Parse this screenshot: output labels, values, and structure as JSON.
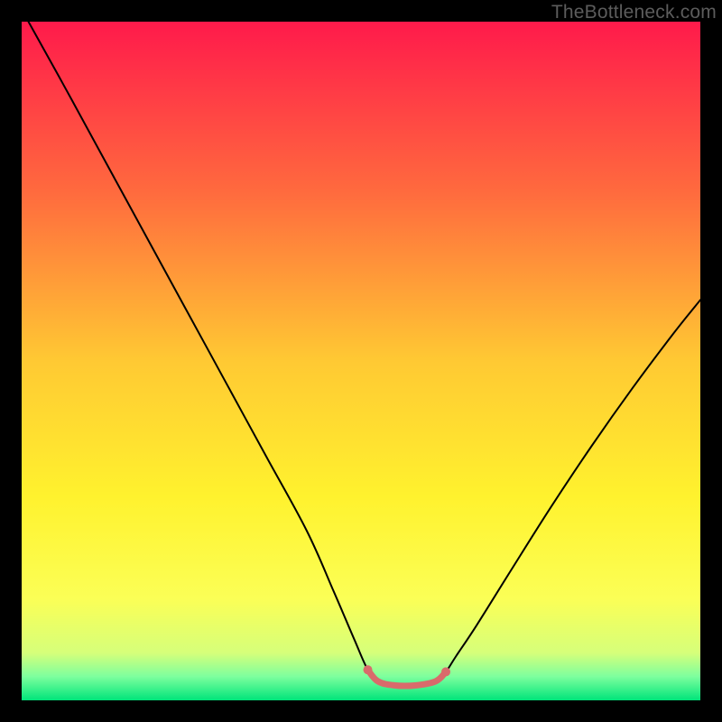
{
  "watermark": {
    "text": "TheBottleneck.com"
  },
  "chart_data": {
    "type": "line",
    "title": "",
    "xlabel": "",
    "ylabel": "",
    "xlim": [
      0,
      100
    ],
    "ylim": [
      0,
      100
    ],
    "grid": false,
    "legend": false,
    "gradient_stops": [
      {
        "offset": 0.0,
        "color": "#ff1a4b"
      },
      {
        "offset": 0.25,
        "color": "#ff6a3e"
      },
      {
        "offset": 0.5,
        "color": "#ffc933"
      },
      {
        "offset": 0.7,
        "color": "#fff22e"
      },
      {
        "offset": 0.85,
        "color": "#fbff56"
      },
      {
        "offset": 0.93,
        "color": "#d6ff7a"
      },
      {
        "offset": 0.965,
        "color": "#7dff9e"
      },
      {
        "offset": 1.0,
        "color": "#00e47a"
      }
    ],
    "series": [
      {
        "name": "curve",
        "stroke": "#000000",
        "stroke_width": 2,
        "x": [
          1.0,
          6.0,
          12.0,
          18.0,
          24.0,
          30.0,
          36.0,
          42.0,
          46.0,
          49.0,
          51.0,
          52.5,
          55.0,
          58.0,
          61.0,
          62.5,
          64.0,
          67.0,
          72.0,
          78.0,
          84.0,
          90.0,
          96.0,
          100.0
        ],
        "y": [
          100.0,
          91.0,
          80.0,
          69.0,
          58.0,
          47.0,
          36.0,
          25.0,
          16.0,
          9.0,
          4.5,
          2.8,
          2.2,
          2.2,
          2.8,
          4.2,
          6.5,
          11.0,
          19.0,
          28.5,
          37.5,
          46.0,
          54.0,
          59.0
        ]
      },
      {
        "name": "highlight",
        "stroke": "#d96b6b",
        "stroke_width": 7,
        "x": [
          51.0,
          52.5,
          55.0,
          58.0,
          61.0,
          62.5
        ],
        "y": [
          4.5,
          2.8,
          2.2,
          2.2,
          2.8,
          4.2
        ]
      }
    ],
    "highlight_endpoints": {
      "color": "#d96b6b",
      "radius": 5,
      "points": [
        {
          "x": 51.0,
          "y": 4.5
        },
        {
          "x": 62.5,
          "y": 4.2
        }
      ]
    }
  }
}
